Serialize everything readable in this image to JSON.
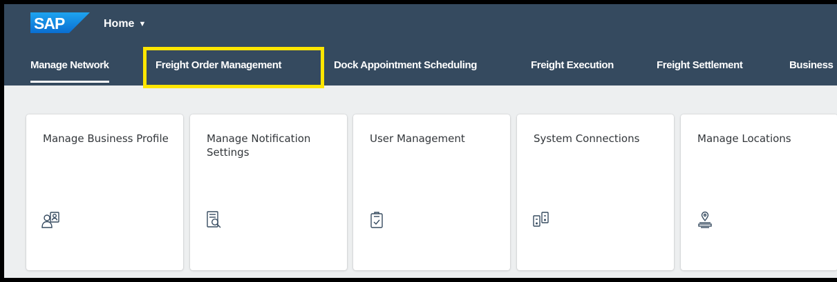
{
  "shell": {
    "logo_text": "SAP",
    "home_label": "Home",
    "home_caret": "▼",
    "brand_color": "#354a5f",
    "highlight_color": "#ffe600"
  },
  "tabs": [
    {
      "label": "Manage Network",
      "active": true
    },
    {
      "label": "Freight Order Management",
      "highlighted": true
    },
    {
      "label": "Dock Appointment Scheduling"
    },
    {
      "label": "Freight Execution"
    },
    {
      "label": "Freight Settlement"
    },
    {
      "label": "Business"
    }
  ],
  "tiles": [
    {
      "title": "Manage Business Profile",
      "icon": "business-profile-icon"
    },
    {
      "title": "Manage Notification Settings",
      "icon": "notification-settings-icon"
    },
    {
      "title": "User Management",
      "icon": "user-management-icon"
    },
    {
      "title": "System Connections",
      "icon": "system-connections-icon"
    },
    {
      "title": "Manage Locations",
      "icon": "locations-icon"
    }
  ]
}
